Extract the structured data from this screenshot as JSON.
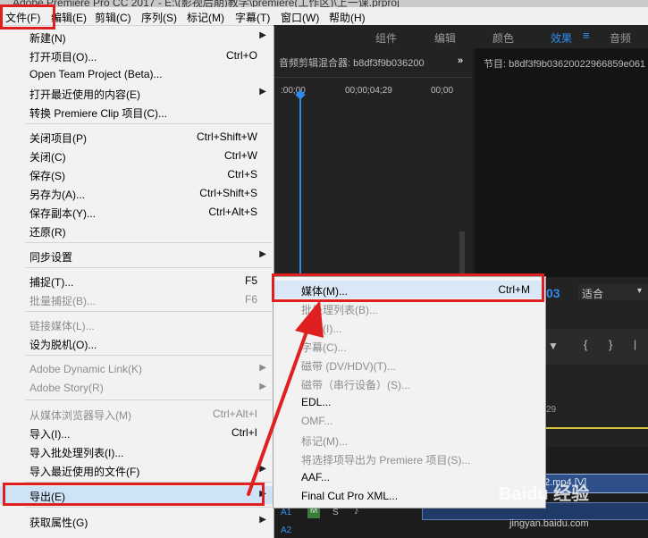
{
  "title_fragment": "Adobe Premiere Pro CC 2017 - E:\\(影视后期)教学\\premiere(工作区)\\上一课.prproj",
  "menubar": {
    "items": [
      "文件(F)",
      "编辑(E)",
      "剪辑(C)",
      "序列(S)",
      "标记(M)",
      "字幕(T)",
      "窗口(W)",
      "帮助(H)"
    ]
  },
  "workspace_tabs": [
    "组件",
    "编辑",
    "颜色",
    "效果",
    "音频"
  ],
  "mixer_panel": {
    "title": "音频剪辑混合器: b8df3f9b036200",
    "timecodes": [
      ":00;00",
      "00;00;04;29",
      "00;00"
    ]
  },
  "program_panel": {
    "title": "节目: b8df3f9b03620022966859e061",
    "fit": "适合",
    "frame_fragment": "03"
  },
  "timeline": {
    "ruler_fragment": "29",
    "track_labels": [
      "A1",
      "A2"
    ],
    "track_buttons": [
      "M",
      "S"
    ],
    "clip_name": "b8df3f9b0361c12f2.mp4 [V]"
  },
  "file_menu": {
    "items": [
      {
        "label": "新建(N)",
        "shortcut": "",
        "submenu": true,
        "disabled": false
      },
      {
        "label": "打开项目(O)...",
        "shortcut": "Ctrl+O",
        "submenu": false,
        "disabled": false
      },
      {
        "label": "Open Team Project (Beta)...",
        "shortcut": "",
        "submenu": false,
        "disabled": false
      },
      {
        "label": "打开最近使用的内容(E)",
        "shortcut": "",
        "submenu": true,
        "disabled": false
      },
      {
        "label": "转换 Premiere Clip 项目(C)...",
        "shortcut": "",
        "submenu": false,
        "disabled": false
      },
      {
        "label": "关闭项目(P)",
        "shortcut": "Ctrl+Shift+W",
        "submenu": false,
        "disabled": false
      },
      {
        "label": "关闭(C)",
        "shortcut": "Ctrl+W",
        "submenu": false,
        "disabled": false
      },
      {
        "label": "保存(S)",
        "shortcut": "Ctrl+S",
        "submenu": false,
        "disabled": false
      },
      {
        "label": "另存为(A)...",
        "shortcut": "Ctrl+Shift+S",
        "submenu": false,
        "disabled": false
      },
      {
        "label": "保存副本(Y)...",
        "shortcut": "Ctrl+Alt+S",
        "submenu": false,
        "disabled": false
      },
      {
        "label": "还原(R)",
        "shortcut": "",
        "submenu": false,
        "disabled": false
      },
      {
        "label": "同步设置",
        "shortcut": "",
        "submenu": true,
        "disabled": false
      },
      {
        "label": "捕捉(T)...",
        "shortcut": "F5",
        "submenu": false,
        "disabled": false
      },
      {
        "label": "批量捕捉(B)...",
        "shortcut": "F6",
        "submenu": false,
        "disabled": true
      },
      {
        "label": "链接媒体(L)...",
        "shortcut": "",
        "submenu": false,
        "disabled": true
      },
      {
        "label": "设为脱机(O)...",
        "shortcut": "",
        "submenu": false,
        "disabled": false
      },
      {
        "label": "Adobe Dynamic Link(K)",
        "shortcut": "",
        "submenu": true,
        "disabled": true
      },
      {
        "label": "Adobe Story(R)",
        "shortcut": "",
        "submenu": true,
        "disabled": true
      },
      {
        "label": "从媒体浏览器导入(M)",
        "shortcut": "Ctrl+Alt+I",
        "submenu": false,
        "disabled": true
      },
      {
        "label": "导入(I)...",
        "shortcut": "Ctrl+I",
        "submenu": false,
        "disabled": false
      },
      {
        "label": "导入批处理列表(I)...",
        "shortcut": "",
        "submenu": false,
        "disabled": false
      },
      {
        "label": "导入最近使用的文件(F)",
        "shortcut": "",
        "submenu": true,
        "disabled": false
      },
      {
        "label": "导出(E)",
        "shortcut": "",
        "submenu": true,
        "disabled": false
      },
      {
        "label": "获取属性(G)",
        "shortcut": "",
        "submenu": true,
        "disabled": false
      }
    ]
  },
  "export_menu": {
    "items": [
      {
        "label": "媒体(M)...",
        "shortcut": "Ctrl+M",
        "disabled": false
      },
      {
        "label": "批处理列表(B)...",
        "shortcut": "",
        "disabled": true
      },
      {
        "label": "标题(I)...",
        "shortcut": "",
        "disabled": true
      },
      {
        "label": "字幕(C)...",
        "shortcut": "",
        "disabled": true
      },
      {
        "label": "磁带 (DV/HDV)(T)...",
        "shortcut": "",
        "disabled": true
      },
      {
        "label": "磁带（串行设备）(S)...",
        "shortcut": "",
        "disabled": true
      },
      {
        "label": "EDL...",
        "shortcut": "",
        "disabled": false
      },
      {
        "label": "OMF...",
        "shortcut": "",
        "disabled": true
      },
      {
        "label": "标记(M)...",
        "shortcut": "",
        "disabled": true
      },
      {
        "label": "将选择项导出为 Premiere 项目(S)...",
        "shortcut": "",
        "disabled": true
      },
      {
        "label": "AAF...",
        "shortcut": "",
        "disabled": false
      },
      {
        "label": "Final Cut Pro XML...",
        "shortcut": "",
        "disabled": false
      }
    ]
  },
  "watermark": {
    "brand": "Baidu 经验",
    "url": "jingyan.baidu.com"
  },
  "colors": {
    "annotation": "#e02020",
    "menu_bg": "#f2f2f2",
    "highlight": "#cfe3f7",
    "accent_blue": "#2d8ceb"
  }
}
